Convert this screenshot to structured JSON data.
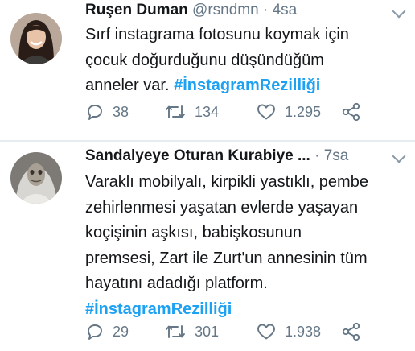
{
  "tweets": [
    {
      "name": "Ruşen Duman",
      "handle": "@rsndmn",
      "separator": "·",
      "time": "4sa",
      "text_lines": [
        "Sırf instagrama fotosunu koymak için",
        "çocuk doğurduğunu düşündüğüm",
        "anneler var. "
      ],
      "hashtag": "#İnstagramRezilliği",
      "replies": "38",
      "retweets": "134",
      "likes": "1.295",
      "icons": [
        "reply-icon",
        "retweet-icon",
        "like-icon",
        "share-icon"
      ]
    },
    {
      "name": "Sandalyeye Oturan Kurabiye ...",
      "separator": "·",
      "time": "7sa",
      "text_lines": [
        "Varaklı mobilyalı, kirpikli yastıklı, pembe",
        "zehirlenmesi yaşatan evlerde yaşayan",
        "koçişinin aşkısı, babişkosunun",
        "premsesi, Zart ile Zurt'un annesinin tüm",
        "hayatını adadığı platform."
      ],
      "hashtag": "#İnstagramRezilliği",
      "replies": "29",
      "retweets": "301",
      "likes": "1.938",
      "icons": [
        "reply-icon",
        "retweet-icon",
        "like-icon",
        "share-icon"
      ]
    }
  ],
  "colors": {
    "text": "#14171a",
    "secondary": "#657786",
    "hashtag": "#1da1f2",
    "divider": "#e6ecf0"
  }
}
